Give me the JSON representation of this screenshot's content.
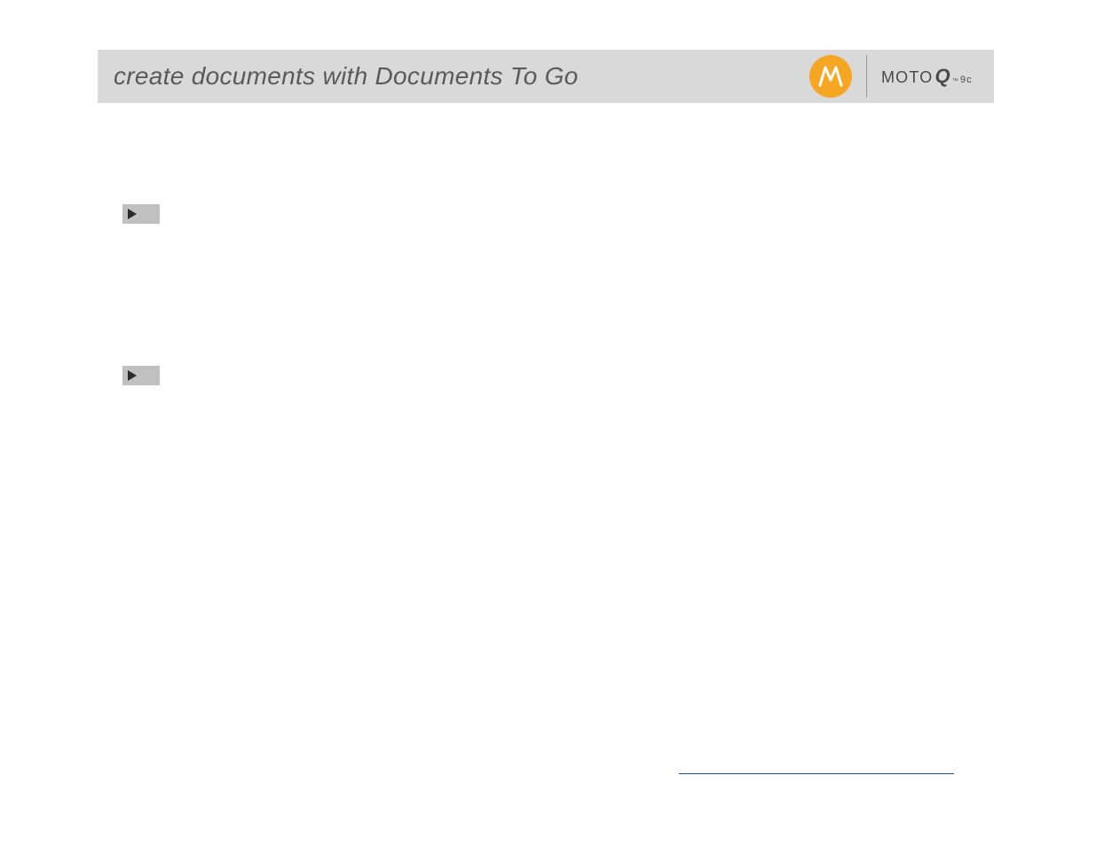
{
  "header": {
    "title": "create documents with Documents To Go",
    "brand_label_parts": {
      "moto": "MOTO",
      "q": "Q",
      "tm": "™",
      "suffix": "9c"
    }
  },
  "colors": {
    "header_bg": "#d9d9d9",
    "header_text": "#5a5a5a",
    "moto_circle": "#f5a623",
    "bullet_bg": "#c0c0c0",
    "bullet_arrow": "#2a2a2a",
    "link_underline": "#2040d0"
  },
  "bullets": [
    {
      "id": 1
    },
    {
      "id": 2
    }
  ],
  "footer_link": {
    "visible": true
  }
}
